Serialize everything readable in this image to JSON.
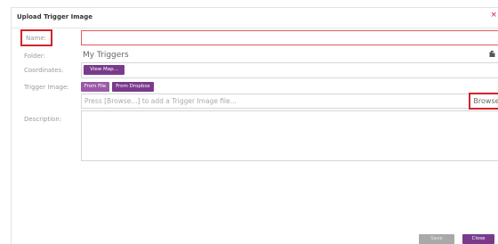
{
  "dialog": {
    "title": "Upload Trigger Image",
    "close_glyph": "×"
  },
  "form": {
    "name_label": "Name:",
    "name_value": "",
    "folder_label": "Folder:",
    "folder_value": "My Triggers",
    "coordinates_label": "Coordinates:",
    "view_map_label": "View Map...",
    "trigger_image_label": "Trigger Image:",
    "from_file_label": "From File",
    "from_dropbox_label": "From Dropbox",
    "trigger_placeholder": "Press [Browse...] to add a Trigger Image file...",
    "browse_label": "Browse",
    "description_label": "Description:",
    "description_value": ""
  },
  "footer": {
    "save_label": "Save",
    "close_label": "Close"
  },
  "colors": {
    "accent_purple": "#7a3a8c",
    "highlight_red": "#d4232b",
    "disabled_gray": "#a9a9a9"
  },
  "icons": {
    "folder": "folder-icon",
    "close": "close-icon"
  }
}
